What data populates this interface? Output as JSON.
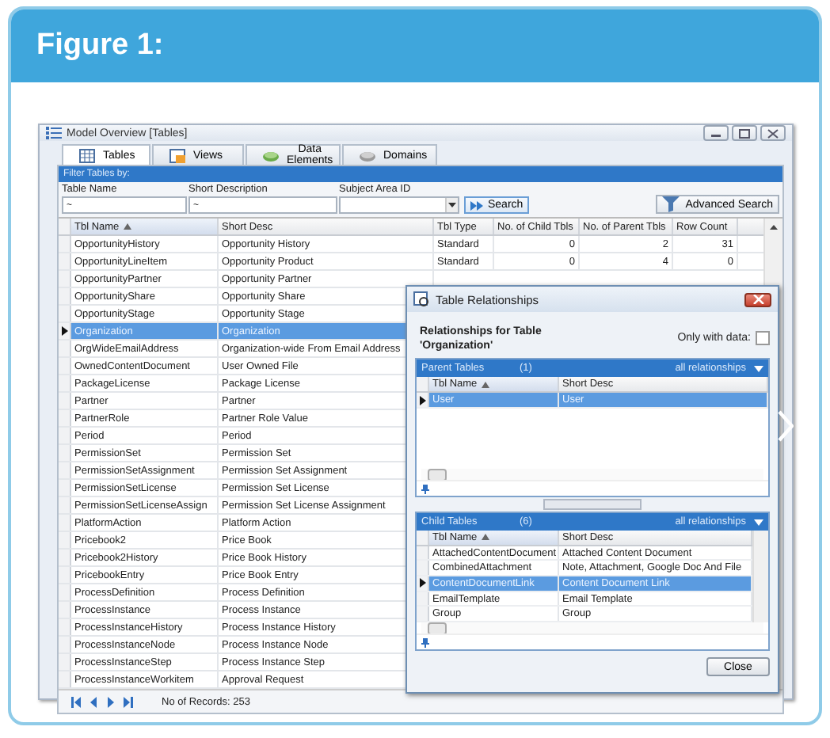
{
  "figure_title": "Figure 1:",
  "window": {
    "title": "Model Overview [Tables]"
  },
  "tabs": [
    {
      "label": "Tables",
      "selected": true
    },
    {
      "label": "Views",
      "selected": false
    },
    {
      "label": "Data Elements",
      "selected": false
    },
    {
      "label": "Domains",
      "selected": false
    }
  ],
  "filter": {
    "heading": "Filter Tables by:",
    "fields": [
      {
        "label": "Table Name",
        "kind": "text",
        "value": "~"
      },
      {
        "label": "Short Description",
        "kind": "text",
        "value": "~"
      },
      {
        "label": "Subject Area ID",
        "kind": "dropdown"
      }
    ],
    "search_button": "Search",
    "advanced_search_button": "Advanced Search"
  },
  "table": {
    "columns": [
      {
        "label": "Tbl Name",
        "sorted": true
      },
      {
        "label": "Short Desc",
        "sorted": false
      },
      {
        "label": "Tbl Type",
        "sorted": false
      },
      {
        "label": "No. of Child Tbls",
        "sorted": false
      },
      {
        "label": "No. of Parent Tbls",
        "sorted": false
      },
      {
        "label": "Row Count",
        "sorted": false
      }
    ],
    "rows": [
      {
        "cells": [
          "OpportunityHistory",
          "Opportunity History",
          "Standard",
          "0",
          "2",
          "31"
        ],
        "selected": false
      },
      {
        "cells": [
          "OpportunityLineItem",
          "Opportunity Product",
          "Standard",
          "0",
          "4",
          "0"
        ],
        "selected": false
      },
      {
        "cells": [
          "OpportunityPartner",
          "Opportunity Partner"
        ],
        "selected": false
      },
      {
        "cells": [
          "OpportunityShare",
          "Opportunity Share"
        ],
        "selected": false
      },
      {
        "cells": [
          "OpportunityStage",
          "Opportunity Stage"
        ],
        "selected": false
      },
      {
        "cells": [
          "Organization",
          "Organization"
        ],
        "selected": true
      },
      {
        "cells": [
          "OrgWideEmailAddress",
          "Organization-wide From Email Address"
        ],
        "selected": false
      },
      {
        "cells": [
          "OwnedContentDocument",
          "User Owned File"
        ],
        "selected": false
      },
      {
        "cells": [
          "PackageLicense",
          "Package License"
        ],
        "selected": false
      },
      {
        "cells": [
          "Partner",
          "Partner"
        ],
        "selected": false
      },
      {
        "cells": [
          "PartnerRole",
          "Partner Role Value"
        ],
        "selected": false
      },
      {
        "cells": [
          "Period",
          "Period"
        ],
        "selected": false
      },
      {
        "cells": [
          "PermissionSet",
          "Permission Set"
        ],
        "selected": false
      },
      {
        "cells": [
          "PermissionSetAssignment",
          "Permission Set Assignment"
        ],
        "selected": false
      },
      {
        "cells": [
          "PermissionSetLicense",
          "Permission Set License"
        ],
        "selected": false
      },
      {
        "cells": [
          "PermissionSetLicenseAssign",
          "Permission Set License Assignment"
        ],
        "selected": false
      },
      {
        "cells": [
          "PlatformAction",
          "Platform Action"
        ],
        "selected": false
      },
      {
        "cells": [
          "Pricebook2",
          "Price Book"
        ],
        "selected": false
      },
      {
        "cells": [
          "Pricebook2History",
          "Price Book History"
        ],
        "selected": false
      },
      {
        "cells": [
          "PricebookEntry",
          "Price Book Entry"
        ],
        "selected": false
      },
      {
        "cells": [
          "ProcessDefinition",
          "Process Definition"
        ],
        "selected": false
      },
      {
        "cells": [
          "ProcessInstance",
          "Process Instance"
        ],
        "selected": false
      },
      {
        "cells": [
          "ProcessInstanceHistory",
          "Process Instance History"
        ],
        "selected": false
      },
      {
        "cells": [
          "ProcessInstanceNode",
          "Process Instance Node"
        ],
        "selected": false
      },
      {
        "cells": [
          "ProcessInstanceStep",
          "Process Instance Step"
        ],
        "selected": false
      },
      {
        "cells": [
          "ProcessInstanceWorkitem",
          "Approval Request"
        ],
        "selected": false
      }
    ]
  },
  "footer": {
    "records": "No of Records: 253"
  },
  "dialog": {
    "title": "Table Relationships",
    "heading": "Relationships for Table 'Organization'",
    "only_with_data": {
      "label": "Only with data:",
      "checked": false
    },
    "panels": [
      {
        "title": "Parent Tables",
        "count": "(1)",
        "filter": "all relationships",
        "columns": [
          {
            "label": "Tbl Name",
            "sorted": true
          },
          {
            "label": "Short Desc",
            "sorted": false
          }
        ],
        "rows": [
          {
            "cells": [
              "User",
              "User"
            ],
            "selected": true
          }
        ]
      },
      {
        "title": "Child Tables",
        "count": "(6)",
        "filter": "all relationships",
        "columns": [
          {
            "label": "Tbl Name",
            "sorted": true
          },
          {
            "label": "Short Desc",
            "sorted": false
          }
        ],
        "rows": [
          {
            "cells": [
              "AttachedContentDocument",
              "Attached Content Document"
            ],
            "selected": false
          },
          {
            "cells": [
              "CombinedAttachment",
              "Note, Attachment, Google Doc And File"
            ],
            "selected": false
          },
          {
            "cells": [
              "ContentDocumentLink",
              "Content Document Link"
            ],
            "selected": true
          },
          {
            "cells": [
              "EmailTemplate",
              "Email Template"
            ],
            "selected": false
          },
          {
            "cells": [
              "Group",
              "Group"
            ],
            "selected": false
          }
        ]
      }
    ],
    "close_button": "Close"
  }
}
